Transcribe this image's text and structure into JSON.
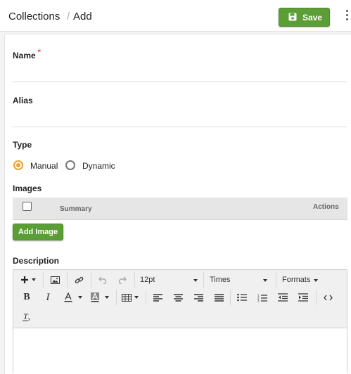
{
  "header": {
    "breadcrumb_parent": "Collections",
    "breadcrumb_separator": "/",
    "breadcrumb_current": "Add",
    "save_label": "Save"
  },
  "form": {
    "name_label": "Name",
    "required_marker": "*",
    "alias_label": "Alias",
    "type_label": "Type",
    "type_options": [
      {
        "label": "Manual",
        "selected": true
      },
      {
        "label": "Dynamic",
        "selected": false
      }
    ],
    "images_label": "Images",
    "images_table": {
      "columns": [
        "Summary",
        "Actions"
      ],
      "rows": []
    },
    "add_image_label": "Add Image",
    "description_label": "Description"
  },
  "editor": {
    "font_size": "12pt",
    "font_family": "Times",
    "formats_label": "Formats"
  },
  "colors": {
    "accent_green": "#5b9e35",
    "radio_selected": "#f0a030",
    "required_red": "#d9534f"
  }
}
